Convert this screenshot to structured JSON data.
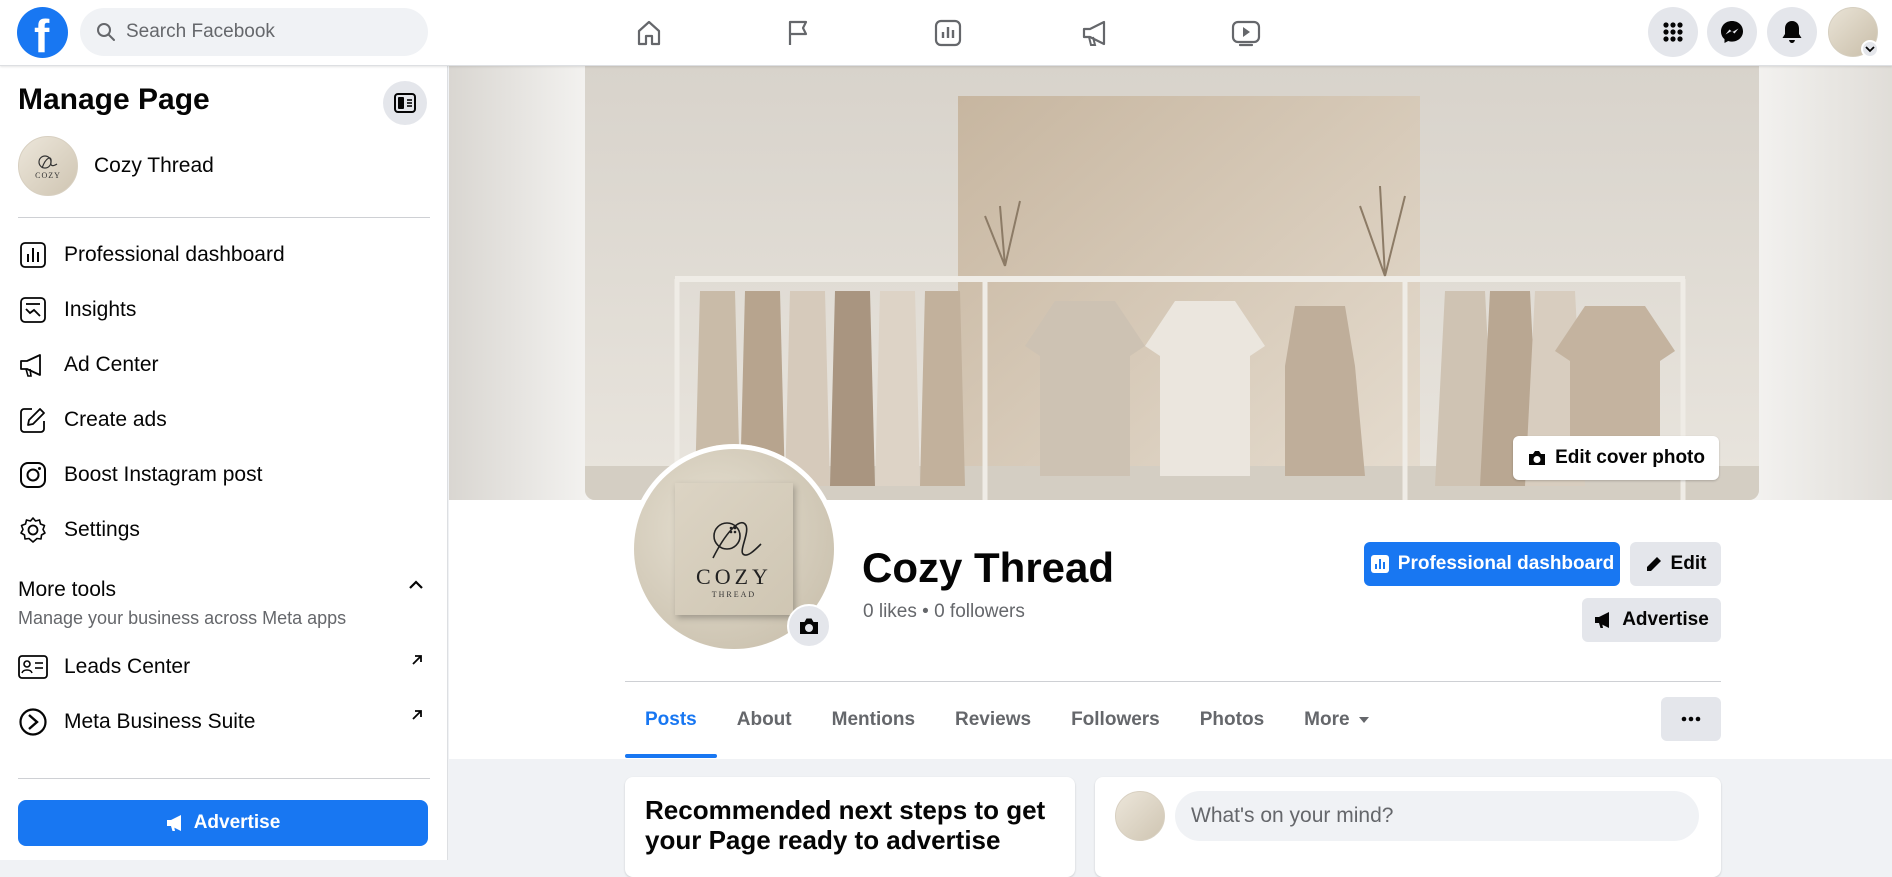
{
  "topbar": {
    "search_placeholder": "Search Facebook"
  },
  "sidebar": {
    "title": "Manage Page",
    "page_name": "Cozy Thread",
    "items": [
      {
        "label": "Professional dashboard",
        "icon": "dashboard-icon"
      },
      {
        "label": "Insights",
        "icon": "insights-icon"
      },
      {
        "label": "Ad Center",
        "icon": "megaphone-icon"
      },
      {
        "label": "Create ads",
        "icon": "pencil-square-icon"
      },
      {
        "label": "Boost Instagram post",
        "icon": "instagram-icon"
      },
      {
        "label": "Settings",
        "icon": "gear-icon"
      }
    ],
    "more_tools": {
      "title": "More tools",
      "subtitle": "Manage your business across Meta apps",
      "items": [
        {
          "label": "Leads Center",
          "icon": "leads-icon"
        },
        {
          "label": "Meta Business Suite",
          "icon": "meta-business-icon"
        }
      ]
    },
    "advertise_label": "Advertise"
  },
  "profile": {
    "name": "Cozy Thread",
    "stats": "0 likes • 0 followers",
    "logo_text": "COZY",
    "logo_sub": "THREAD",
    "edit_cover_label": "Edit cover photo",
    "buttons": {
      "professional_dashboard": "Professional dashboard",
      "edit": "Edit",
      "advertise": "Advertise"
    }
  },
  "tabs": [
    {
      "label": "Posts",
      "active": true
    },
    {
      "label": "About"
    },
    {
      "label": "Mentions"
    },
    {
      "label": "Reviews"
    },
    {
      "label": "Followers"
    },
    {
      "label": "Photos"
    },
    {
      "label": "More"
    }
  ],
  "cards": {
    "recommended_title": "Recommended next steps to get your Page ready to advertise",
    "composer_placeholder": "What's on your mind?"
  },
  "colors": {
    "brand_blue": "#1877f2",
    "background": "#f0f2f5",
    "button_gray": "#e4e6eb"
  }
}
